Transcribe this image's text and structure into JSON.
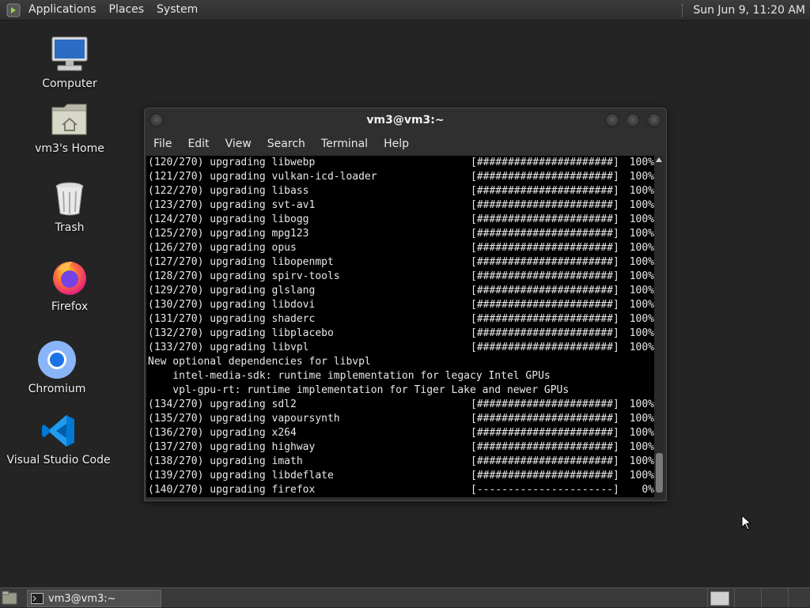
{
  "top_panel": {
    "menus": [
      "Applications",
      "Places",
      "System"
    ],
    "clock": "Sun Jun  9, 11:20 AM"
  },
  "desktop_icons": [
    {
      "label": "Computer",
      "icon": "computer-icon"
    },
    {
      "label": "vm3's Home",
      "icon": "home-folder-icon"
    },
    {
      "label": "Trash",
      "icon": "trash-icon"
    },
    {
      "label": "Firefox",
      "icon": "firefox-icon"
    },
    {
      "label": "Chromium",
      "icon": "chromium-icon"
    },
    {
      "label": "Visual Studio Code",
      "icon": "vscode-icon"
    }
  ],
  "terminal": {
    "title": "vm3@vm3:~",
    "menu": [
      "File",
      "Edit",
      "View",
      "Search",
      "Terminal",
      "Help"
    ],
    "lines": [
      {
        "text": "(120/270) upgrading libwebp",
        "bar": "[######################]",
        "pct": "100%"
      },
      {
        "text": "(121/270) upgrading vulkan-icd-loader",
        "bar": "[######################]",
        "pct": "100%"
      },
      {
        "text": "(122/270) upgrading libass",
        "bar": "[######################]",
        "pct": "100%"
      },
      {
        "text": "(123/270) upgrading svt-av1",
        "bar": "[######################]",
        "pct": "100%"
      },
      {
        "text": "(124/270) upgrading libogg",
        "bar": "[######################]",
        "pct": "100%"
      },
      {
        "text": "(125/270) upgrading mpg123",
        "bar": "[######################]",
        "pct": "100%"
      },
      {
        "text": "(126/270) upgrading opus",
        "bar": "[######################]",
        "pct": "100%"
      },
      {
        "text": "(127/270) upgrading libopenmpt",
        "bar": "[######################]",
        "pct": "100%"
      },
      {
        "text": "(128/270) upgrading spirv-tools",
        "bar": "[######################]",
        "pct": "100%"
      },
      {
        "text": "(129/270) upgrading glslang",
        "bar": "[######################]",
        "pct": "100%"
      },
      {
        "text": "(130/270) upgrading libdovi",
        "bar": "[######################]",
        "pct": "100%"
      },
      {
        "text": "(131/270) upgrading shaderc",
        "bar": "[######################]",
        "pct": "100%"
      },
      {
        "text": "(132/270) upgrading libplacebo",
        "bar": "[######################]",
        "pct": "100%"
      },
      {
        "text": "(133/270) upgrading libvpl",
        "bar": "[######################]",
        "pct": "100%"
      },
      {
        "text": "New optional dependencies for libvpl",
        "bar": "",
        "pct": ""
      },
      {
        "text": "    intel-media-sdk: runtime implementation for legacy Intel GPUs",
        "bar": "",
        "pct": ""
      },
      {
        "text": "    vpl-gpu-rt: runtime implementation for Tiger Lake and newer GPUs",
        "bar": "",
        "pct": ""
      },
      {
        "text": "(134/270) upgrading sdl2",
        "bar": "[######################]",
        "pct": "100%"
      },
      {
        "text": "(135/270) upgrading vapoursynth",
        "bar": "[######################]",
        "pct": "100%"
      },
      {
        "text": "(136/270) upgrading x264",
        "bar": "[######################]",
        "pct": "100%"
      },
      {
        "text": "(137/270) upgrading highway",
        "bar": "[######################]",
        "pct": "100%"
      },
      {
        "text": "(138/270) upgrading imath",
        "bar": "[######################]",
        "pct": "100%"
      },
      {
        "text": "(139/270) upgrading libdeflate",
        "bar": "[######################]",
        "pct": "100%"
      },
      {
        "text": "(140/270) upgrading firefox",
        "bar": "[----------------------]",
        "pct": "0%"
      }
    ]
  },
  "taskbar": {
    "task_label": "vm3@vm3:~"
  }
}
